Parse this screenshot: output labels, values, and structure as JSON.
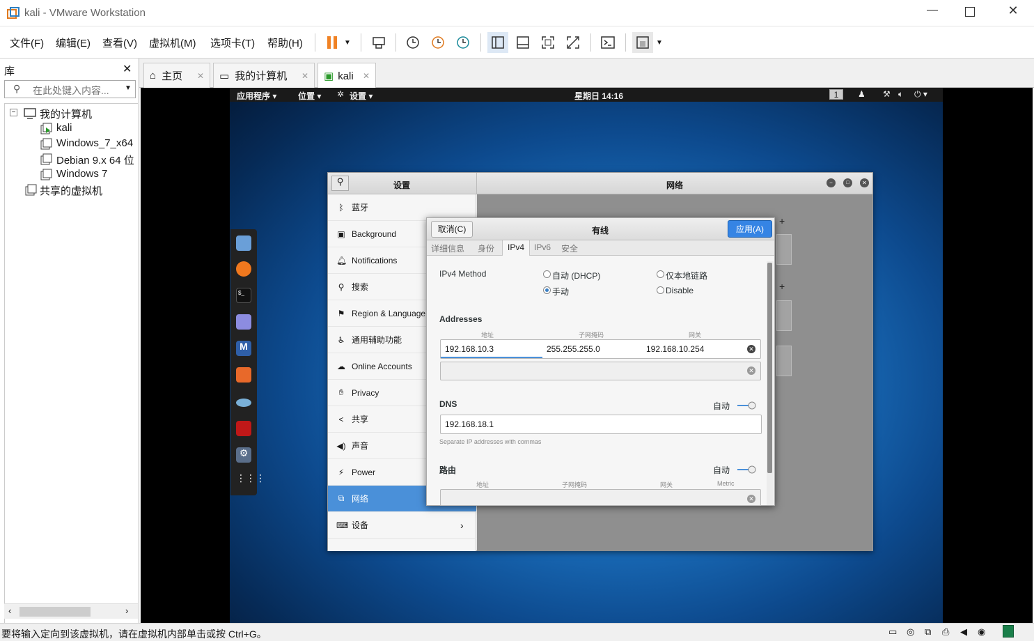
{
  "window": {
    "title": "kali - VMware Workstation"
  },
  "menu": [
    "文件(F)",
    "编辑(E)",
    "查看(V)",
    "虚拟机(M)",
    "选项卡(T)",
    "帮助(H)"
  ],
  "library": {
    "title": "库",
    "search_placeholder": "在此处键入内容...",
    "tree": [
      {
        "label": "我的计算机"
      },
      {
        "label": "kali"
      },
      {
        "label": "Windows_7_x64"
      },
      {
        "label": "Debian 9.x 64 位"
      },
      {
        "label": "Windows 7"
      },
      {
        "label": "共享的虚拟机"
      }
    ]
  },
  "tabs": [
    {
      "label": "主页"
    },
    {
      "label": "我的计算机"
    },
    {
      "label": "kali"
    }
  ],
  "gnome": {
    "apps": "应用程序 ▾",
    "places": "位置 ▾",
    "settings": "设置 ▾",
    "clock": "星期日 14:16",
    "workspace": "1"
  },
  "settings": {
    "title": "设置",
    "panel_title": "网络",
    "items": [
      "蓝牙",
      "Background",
      "Notifications",
      "搜索",
      "Region & Language",
      "通用辅助功能",
      "Online Accounts",
      "Privacy",
      "共享",
      "声音",
      "Power",
      "网络",
      "设备"
    ]
  },
  "dialog": {
    "cancel": "取消(C)",
    "title": "有线",
    "apply": "应用(A)",
    "tabs": [
      "详细信息",
      "身份",
      "IPv4",
      "IPv6",
      "安全"
    ],
    "ipv4_method_label": "IPv4 Method",
    "methods": [
      "自动 (DHCP)",
      "仅本地链路",
      "手动",
      "Disable"
    ],
    "addresses_label": "Addresses",
    "col_address": "地址",
    "col_netmask": "子网掩码",
    "col_gateway": "网关",
    "address": "192.168.10.3",
    "netmask": "255.255.255.0",
    "gateway": "192.168.10.254",
    "dns_label": "DNS",
    "auto": "自动",
    "dns": "192.168.18.1",
    "dns_hint": "Separate IP addresses with commas",
    "routes_label": "路由",
    "col_metric": "Metric"
  },
  "statusbar": {
    "text": "要将输入定向到该虚拟机，请在虚拟机内部单击或按 Ctrl+G。"
  },
  "colors": {
    "accent": "#3584e4",
    "selected": "#4a90d9"
  }
}
